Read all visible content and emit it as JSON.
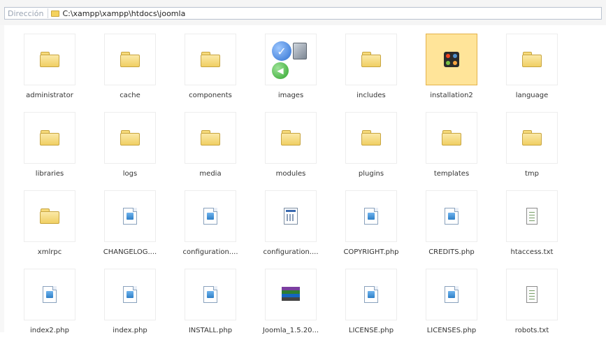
{
  "address_bar": {
    "label": "Dirección",
    "path": "C:\\xampp\\xampp\\htdocs\\joomla"
  },
  "items": [
    {
      "name": "administrator",
      "type": "folder"
    },
    {
      "name": "cache",
      "type": "folder"
    },
    {
      "name": "components",
      "type": "folder"
    },
    {
      "name": "images",
      "type": "images"
    },
    {
      "name": "includes",
      "type": "folder"
    },
    {
      "name": "installation2",
      "type": "joomla"
    },
    {
      "name": "language",
      "type": "folder"
    },
    {
      "name": "libraries",
      "type": "folder"
    },
    {
      "name": "logs",
      "type": "folder"
    },
    {
      "name": "media",
      "type": "folder"
    },
    {
      "name": "modules",
      "type": "folder"
    },
    {
      "name": "plugins",
      "type": "folder"
    },
    {
      "name": "templates",
      "type": "folder"
    },
    {
      "name": "tmp",
      "type": "folder"
    },
    {
      "name": "xmlrpc",
      "type": "folder"
    },
    {
      "name": "CHANGELOG....",
      "type": "php"
    },
    {
      "name": "configuration....",
      "type": "php"
    },
    {
      "name": "configuration....",
      "type": "config"
    },
    {
      "name": "COPYRIGHT.php",
      "type": "php"
    },
    {
      "name": "CREDITS.php",
      "type": "php"
    },
    {
      "name": "htaccess.txt",
      "type": "txt"
    },
    {
      "name": "index2.php",
      "type": "php"
    },
    {
      "name": "index.php",
      "type": "php"
    },
    {
      "name": "INSTALL.php",
      "type": "php"
    },
    {
      "name": "Joomla_1.5.20...",
      "type": "rar"
    },
    {
      "name": "LICENSE.php",
      "type": "php"
    },
    {
      "name": "LICENSES.php",
      "type": "php"
    },
    {
      "name": "robots.txt",
      "type": "txt"
    }
  ],
  "selected_item": "installation2"
}
